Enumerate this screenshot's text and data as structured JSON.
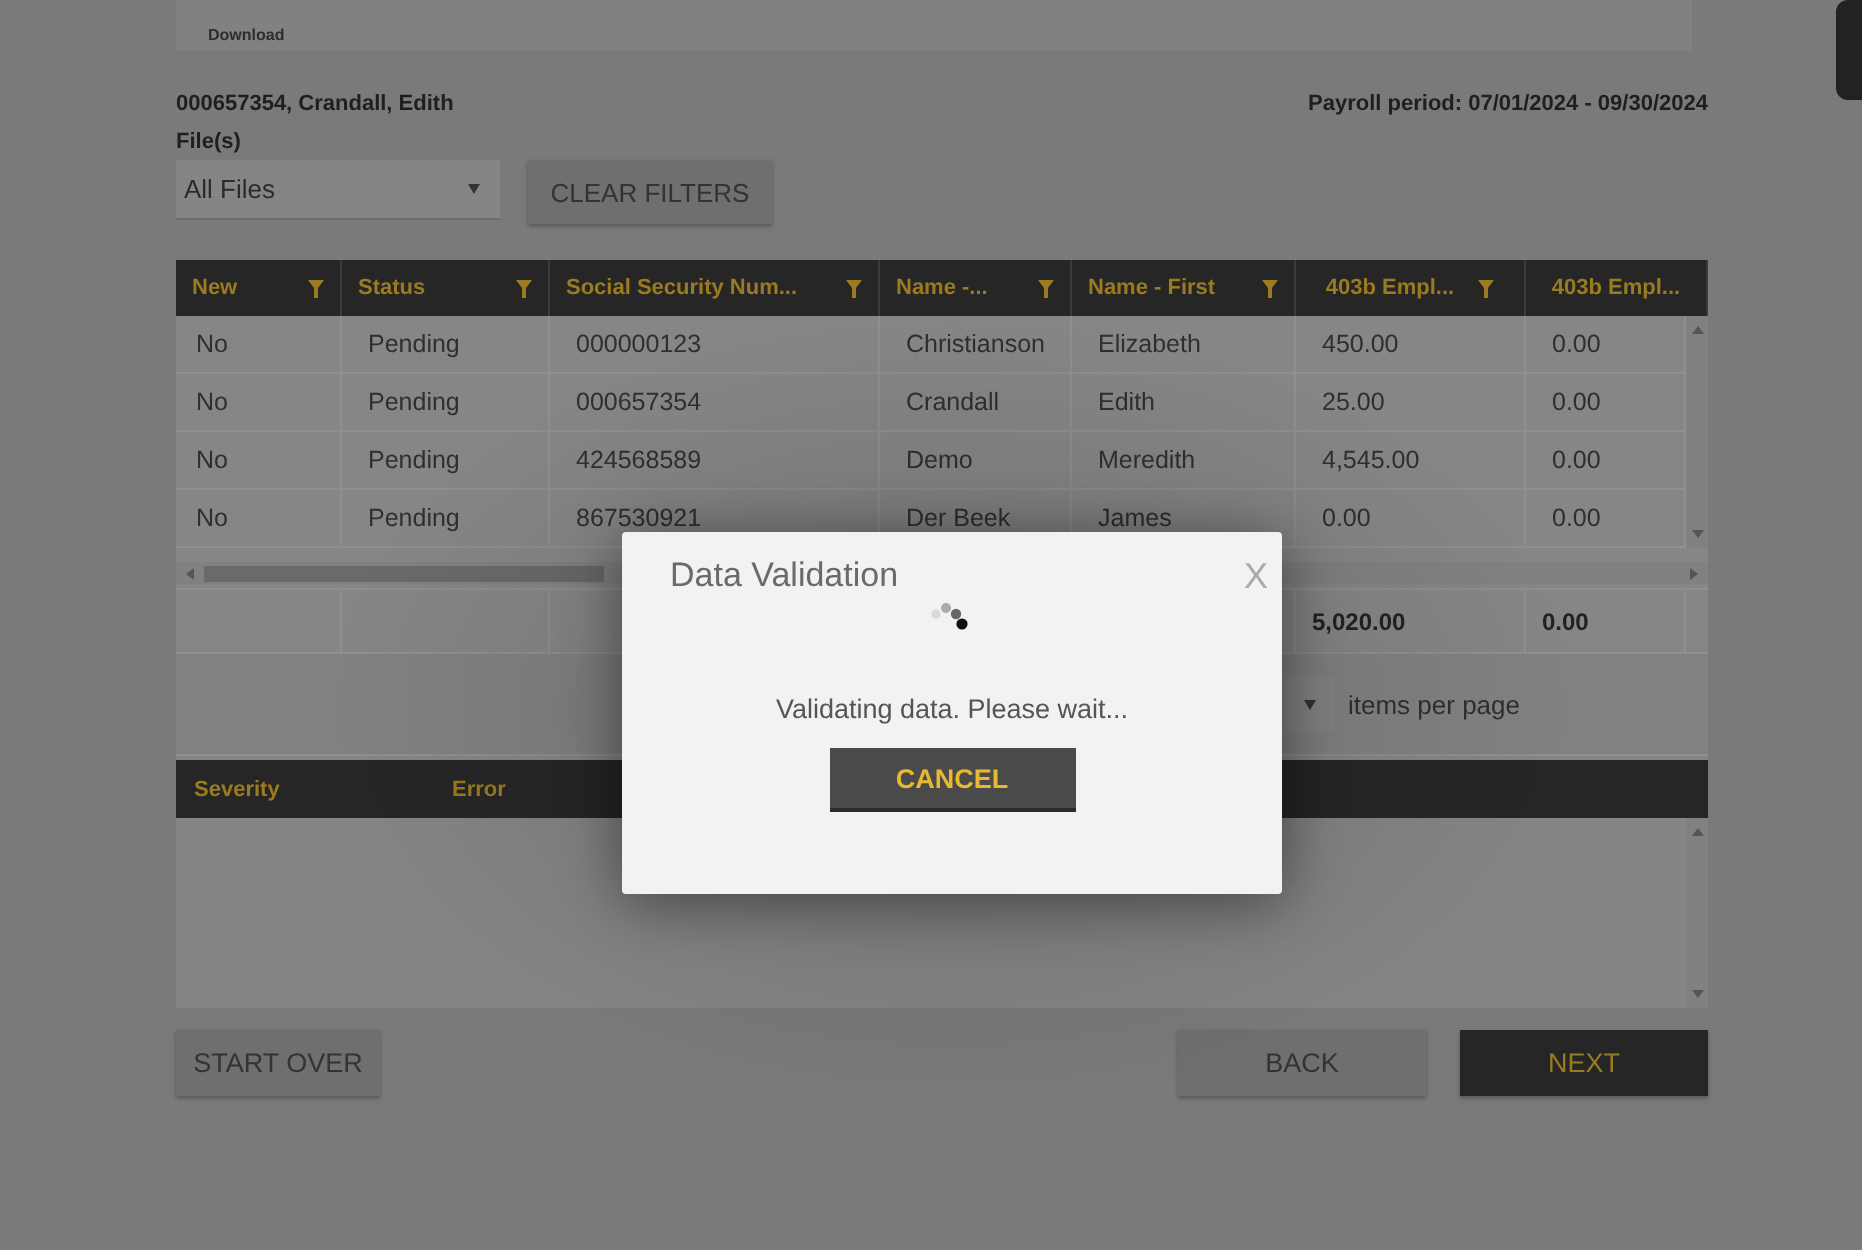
{
  "top_panel": {
    "link": "Download"
  },
  "employee": "000657354, Crandall, Edith",
  "payroll_period": "Payroll period: 07/01/2024 - 09/30/2024",
  "file_filter": {
    "label": "File(s)",
    "value": "All Files"
  },
  "clear_filters_button": "CLEAR FILTERS",
  "table": {
    "columns": [
      {
        "label": "New",
        "filter": true
      },
      {
        "label": "Status",
        "filter": true
      },
      {
        "label": "Social Security Num...",
        "filter": true
      },
      {
        "label": "Name -...",
        "filter": true
      },
      {
        "label": "Name - First",
        "filter": true
      },
      {
        "label": "403b Empl...",
        "filter": true
      },
      {
        "label": "403b Empl...",
        "filter": false
      }
    ],
    "rows": [
      [
        "No",
        "Pending",
        "000000123",
        "Christianson",
        "Elizabeth",
        "450.00",
        "0.00"
      ],
      [
        "No",
        "Pending",
        "000657354",
        "Crandall",
        "Edith",
        "25.00",
        "0.00"
      ],
      [
        "No",
        "Pending",
        "424568589",
        "Demo",
        "Meredith",
        "4,545.00",
        "0.00"
      ],
      [
        "No",
        "Pending",
        "867530921",
        "Der Beek",
        "James",
        "0.00",
        "0.00"
      ]
    ],
    "totals": [
      "5,020.00",
      "0.00"
    ]
  },
  "pager": {
    "label": "items per page"
  },
  "errors_table": {
    "columns": [
      "Severity",
      "Error"
    ]
  },
  "buttons": [
    {
      "label": "START OVER",
      "kind": "secondary"
    },
    {
      "label": "BACK",
      "kind": "secondary"
    },
    {
      "label": "NEXT",
      "kind": "primary"
    }
  ],
  "dialog": {
    "title": "Data Validation",
    "close": "X",
    "message": "Validating data. Please wait...",
    "button": "CANCEL"
  }
}
